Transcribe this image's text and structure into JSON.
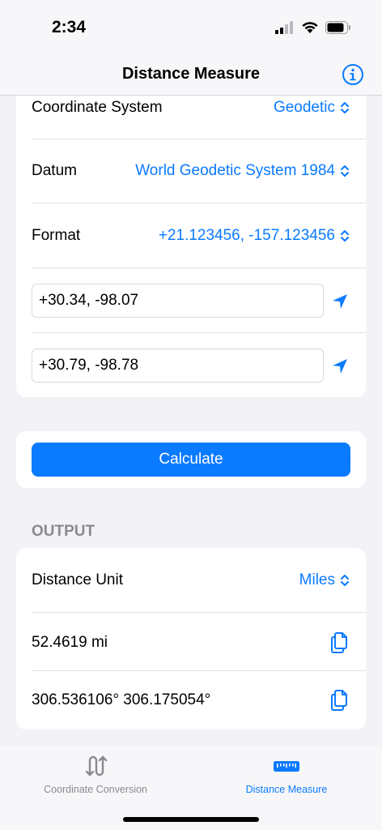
{
  "status": {
    "time": "2:34"
  },
  "nav": {
    "title": "Distance Measure"
  },
  "input_section": {
    "coordinate_system": {
      "label": "Coordinate System",
      "value": "Geodetic"
    },
    "datum": {
      "label": "Datum",
      "value": "World Geodetic System 1984"
    },
    "format": {
      "label": "Format",
      "value": "+21.123456, -157.123456"
    },
    "point1": "+30.34, -98.07",
    "point2": "+30.79, -98.78"
  },
  "calculate_label": "Calculate",
  "output": {
    "header": "OUTPUT",
    "distance_unit": {
      "label": "Distance Unit",
      "value": "Miles"
    },
    "distance": "52.4619 mi",
    "bearings": "306.536106° 306.175054°"
  },
  "tabs": [
    {
      "label": "Coordinate Conversion",
      "active": false
    },
    {
      "label": "Distance Measure",
      "active": true
    }
  ],
  "colors": {
    "accent": "#0a7aff",
    "background": "#f2f2f7",
    "inactive": "#8a8a8e"
  }
}
